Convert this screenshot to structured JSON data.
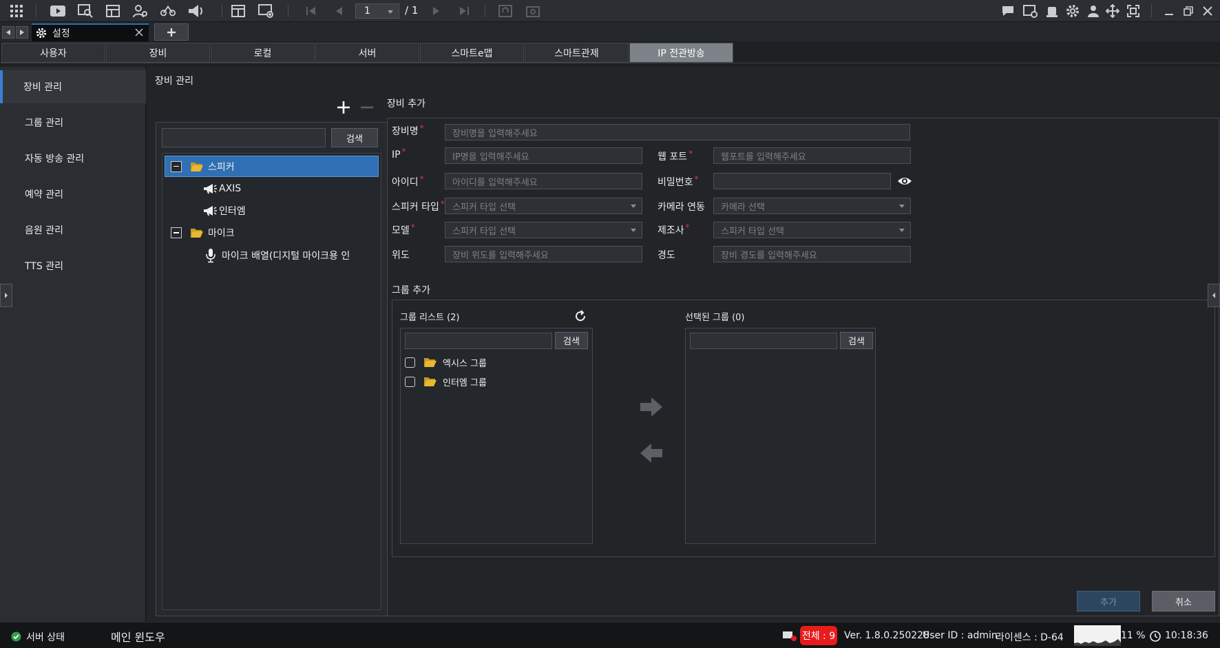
{
  "toolbar": {
    "page_current": "1",
    "page_total": "/ 1"
  },
  "window_tab": {
    "title": "설정"
  },
  "settings_tabs": [
    {
      "label": "사용자"
    },
    {
      "label": "장비"
    },
    {
      "label": "로컬"
    },
    {
      "label": "서버"
    },
    {
      "label": "스마트e맵"
    },
    {
      "label": "스마트관제"
    },
    {
      "label": "IP 전관방송"
    }
  ],
  "sidebar": {
    "items": [
      {
        "label": "장비 관리"
      },
      {
        "label": "그룹 관리"
      },
      {
        "label": "자동 방송 관리"
      },
      {
        "label": "예약 관리"
      },
      {
        "label": "음원 관리"
      },
      {
        "label": "TTS 관리"
      }
    ]
  },
  "main": {
    "title": "장비 관리",
    "tree": {
      "search_button": "검색",
      "search_value": "",
      "nodes": [
        {
          "label": "스피커"
        },
        {
          "label": "AXIS"
        },
        {
          "label": "인터엠"
        },
        {
          "label": "마이크"
        },
        {
          "label": "마이크 배열(디지털 마이크용 인"
        }
      ]
    },
    "form": {
      "section_title": "장비 추가",
      "device_name": {
        "label": "장비명",
        "placeholder": "장비명을 입력해주세요"
      },
      "ip": {
        "label": "IP",
        "placeholder": "IP명을 입력해주세요"
      },
      "web_port": {
        "label": "웹 포트",
        "placeholder": "웹포트를 입력해주세요"
      },
      "user_id": {
        "label": "아이디",
        "placeholder": "아이디를 입력해주세요"
      },
      "password": {
        "label": "비밀번호",
        "placeholder": ""
      },
      "speaker_type": {
        "label": "스피커 타입",
        "placeholder": "스피커 타입 선택"
      },
      "camera_link": {
        "label": "카메라 연동",
        "placeholder": "카메라 선택"
      },
      "model": {
        "label": "모델",
        "placeholder": "스피커 타입 선택"
      },
      "manufacturer": {
        "label": "제조사",
        "placeholder": "스피커 타입 선택"
      },
      "latitude": {
        "label": "위도",
        "placeholder": "장비 위도를 입력해주세요"
      },
      "longitude": {
        "label": "경도",
        "placeholder": "장비 경도를 입력해주세요"
      }
    },
    "group": {
      "section_title": "그룹 추가",
      "list_title": "그룹 리스트 (2)",
      "selected_title": "선택된 그룹 (0)",
      "search_button": "검색",
      "items": [
        {
          "label": "엑시스 그룹"
        },
        {
          "label": "인터엠 그룹"
        }
      ]
    },
    "add_button": "추가",
    "cancel_button": "취소"
  },
  "statusbar": {
    "server_status": "서버 상태",
    "main_window": "메인 윈도우",
    "total_badge": "전체 : 9",
    "version": "Ver. 1.8.0.250228",
    "user_id": "User ID : admin",
    "license": "라이센스 : D-64",
    "cpu": "11 %",
    "time": "10:18:36"
  },
  "colors": {
    "accent": "#3c7fd0",
    "selected_tree": "#2f6fb3",
    "required": "#e0363c",
    "badge": "#e81c1c",
    "folder": "#e8b830"
  }
}
